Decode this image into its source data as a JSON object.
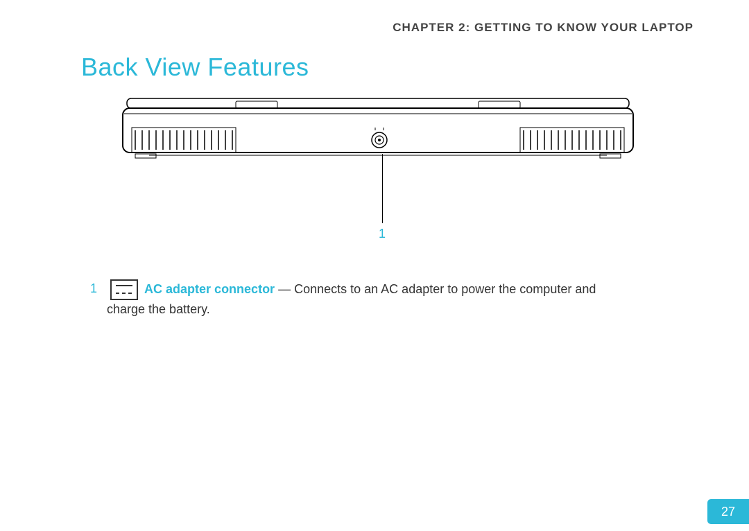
{
  "header": {
    "chapter": "CHAPTER 2: GETTING TO KNOW YOUR LAPTOP"
  },
  "section": {
    "title": "Back View Features"
  },
  "callout": {
    "number": "1"
  },
  "feature": {
    "number": "1",
    "name": "AC adapter connector",
    "separator": " — ",
    "desc_line1": "Connects to an AC adapter to power the computer and",
    "desc_line2": "charge the battery."
  },
  "page": {
    "number": "27"
  }
}
